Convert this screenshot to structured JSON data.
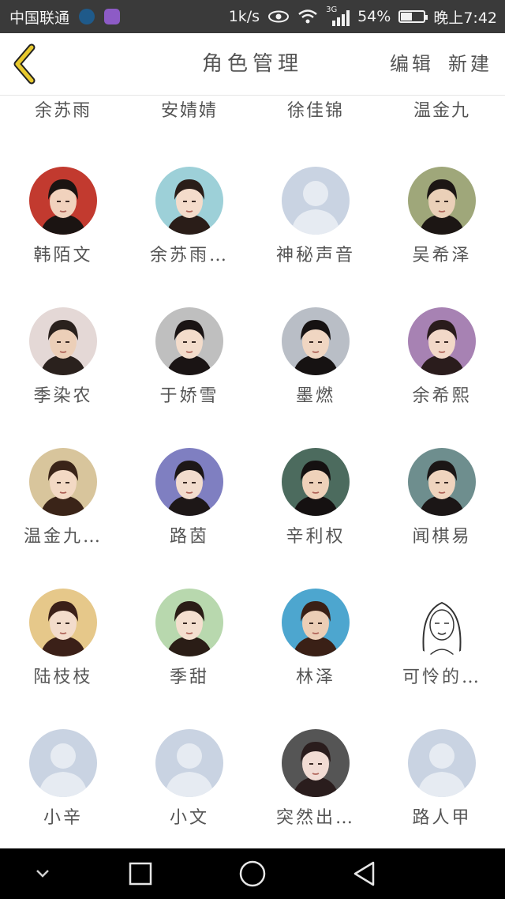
{
  "status_bar": {
    "carrier": "中国联通",
    "speed": "1k/s",
    "network": "3G",
    "battery_percent": "54%",
    "battery_level": 0.54,
    "time": "晚上7:42"
  },
  "header": {
    "title": "角色管理",
    "edit_label": "编辑",
    "new_label": "新建"
  },
  "colors": {
    "placeholder_bg": "#c9d3e2",
    "placeholder_fg": "#e6ebf2",
    "back_arrow": "#e8c92e"
  },
  "top_names": [
    "余苏雨",
    "安婧婧",
    "徐佳锦",
    "温金九"
  ],
  "characters": [
    [
      {
        "name": "韩陌文",
        "avatar": "portrait",
        "skin": "#f1d2bd",
        "hair": "#1b1412",
        "bg": "#c23a2f"
      },
      {
        "name": "余苏雨…",
        "avatar": "portrait",
        "skin": "#f4dccb",
        "hair": "#2a1d18",
        "bg": "#9dd0d8"
      },
      {
        "name": "神秘声音",
        "avatar": "placeholder"
      },
      {
        "name": "吴希泽",
        "avatar": "portrait",
        "skin": "#ead0b8",
        "hair": "#1c1614",
        "bg": "#9fa77a"
      }
    ],
    [
      {
        "name": "季染农",
        "avatar": "portrait",
        "skin": "#eccfb8",
        "hair": "#2a211d",
        "bg": "#e4d8d6"
      },
      {
        "name": "于娇雪",
        "avatar": "portrait",
        "skin": "#f3dccb",
        "hair": "#1a1414",
        "bg": "#bfbfbf"
      },
      {
        "name": "墨燃",
        "avatar": "portrait",
        "skin": "#f0d6c2",
        "hair": "#161212",
        "bg": "#b9bec6"
      },
      {
        "name": "余希熙",
        "avatar": "portrait",
        "skin": "#f2d8c8",
        "hair": "#2a1c1c",
        "bg": "#a782b3"
      }
    ],
    [
      {
        "name": "温金九…",
        "avatar": "portrait",
        "skin": "#f3d9c4",
        "hair": "#3a2418",
        "bg": "#d8c59c"
      },
      {
        "name": "路茵",
        "avatar": "portrait",
        "skin": "#f2dccd",
        "hair": "#1d1717",
        "bg": "#7f7fc1"
      },
      {
        "name": "辛利权",
        "avatar": "portrait",
        "skin": "#efd2ba",
        "hair": "#151111",
        "bg": "#4c6b5e"
      },
      {
        "name": "闻棋易",
        "avatar": "portrait",
        "skin": "#efd4be",
        "hair": "#1b1616",
        "bg": "#6e8e8e"
      }
    ],
    [
      {
        "name": "陆枝枝",
        "avatar": "portrait",
        "skin": "#f3dccb",
        "hair": "#3b2018",
        "bg": "#e6c88a"
      },
      {
        "name": "季甜",
        "avatar": "portrait",
        "skin": "#f4dfcf",
        "hair": "#2a1d16",
        "bg": "#b8d8ae"
      },
      {
        "name": "林泽",
        "avatar": "portrait",
        "skin": "#ecceb6",
        "hair": "#3a2016",
        "bg": "#4da6cf"
      },
      {
        "name": "可怜的…",
        "avatar": "sketch",
        "skin": "#ffffff",
        "hair": "#333333",
        "bg": "#ffffff"
      }
    ],
    [
      {
        "name": "小辛",
        "avatar": "placeholder"
      },
      {
        "name": "小文",
        "avatar": "placeholder"
      },
      {
        "name": "突然出…",
        "avatar": "portrait",
        "skin": "#f1dcd4",
        "hair": "#2a1d1d",
        "bg": "#555555"
      },
      {
        "name": "路人甲",
        "avatar": "placeholder"
      }
    ]
  ]
}
